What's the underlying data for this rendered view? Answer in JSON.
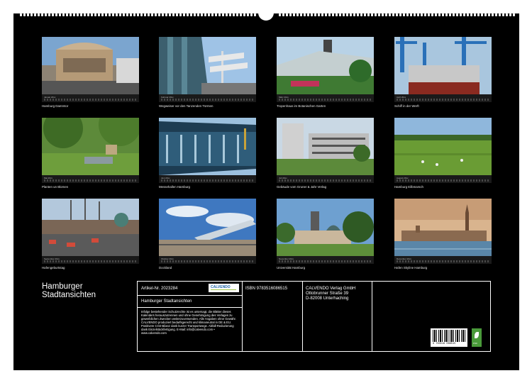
{
  "tiles": [
    {
      "caption": "Hamburg Dammtor",
      "month": "Januar 20xx"
    },
    {
      "caption": "Wegweiser vor den Tanzenden Türmen",
      "month": "Februar 20xx"
    },
    {
      "caption": "Tropenhaus im Botanischen Garten",
      "month": "März 20xx"
    },
    {
      "caption": "Schiff in der Werft",
      "month": "April 20xx"
    },
    {
      "caption": "Planten un Blomen",
      "month": "Mai 20xx"
    },
    {
      "caption": "Messehallen Hamburg",
      "month": "Juni 20xx"
    },
    {
      "caption": "Gebäude vom Gruner & Jahr Verlag",
      "month": "Juli 20xx"
    },
    {
      "caption": "Hamburg Eilbmarsch",
      "month": "August 20xx"
    },
    {
      "caption": "Hafengeburtstag",
      "month": "September 20xx"
    },
    {
      "caption": "Dockland",
      "month": "Oktober 20xx"
    },
    {
      "caption": "Universität Hamburg",
      "month": "November 20xx"
    },
    {
      "caption": "Hafen Skyline Hamburg",
      "month": "Dezember 20xx"
    }
  ],
  "title_line1": "Hamburger",
  "title_line2": "Stadtansichten",
  "info": {
    "article": "Artikel-Nr. 2023284",
    "product_title": "Hamburger Stadtansichten",
    "isbn": "ISBN 9783516086515",
    "publisher": "CALVENDO Verlag GmbH",
    "street": "Ottobrunner Straße 39",
    "city": "D-82008 Unterhaching",
    "logo": "CALVENDO",
    "legal": "Infolge bestehender Schutzrechte ist es untersagt, die Blätter dieses Kalenders herauszutrennen und ohne Genehmigung des Verlages zu gewerblichen Zwecken weiterzuverwenden. Alle Angaben ohne Gewähr. CALVENDO produziert bedarfsgerecht und klimaneutral in DE & EU. Positivere CO2-Bilanz dank kurzer Transportwege. Abfall-Reduzierung dank Einzelstückfertigung. E-Mail: info@calvendo.com • www.calvendo.com",
    "barcode_digits": "9 783516 086515",
    "fsc": "FSC"
  }
}
